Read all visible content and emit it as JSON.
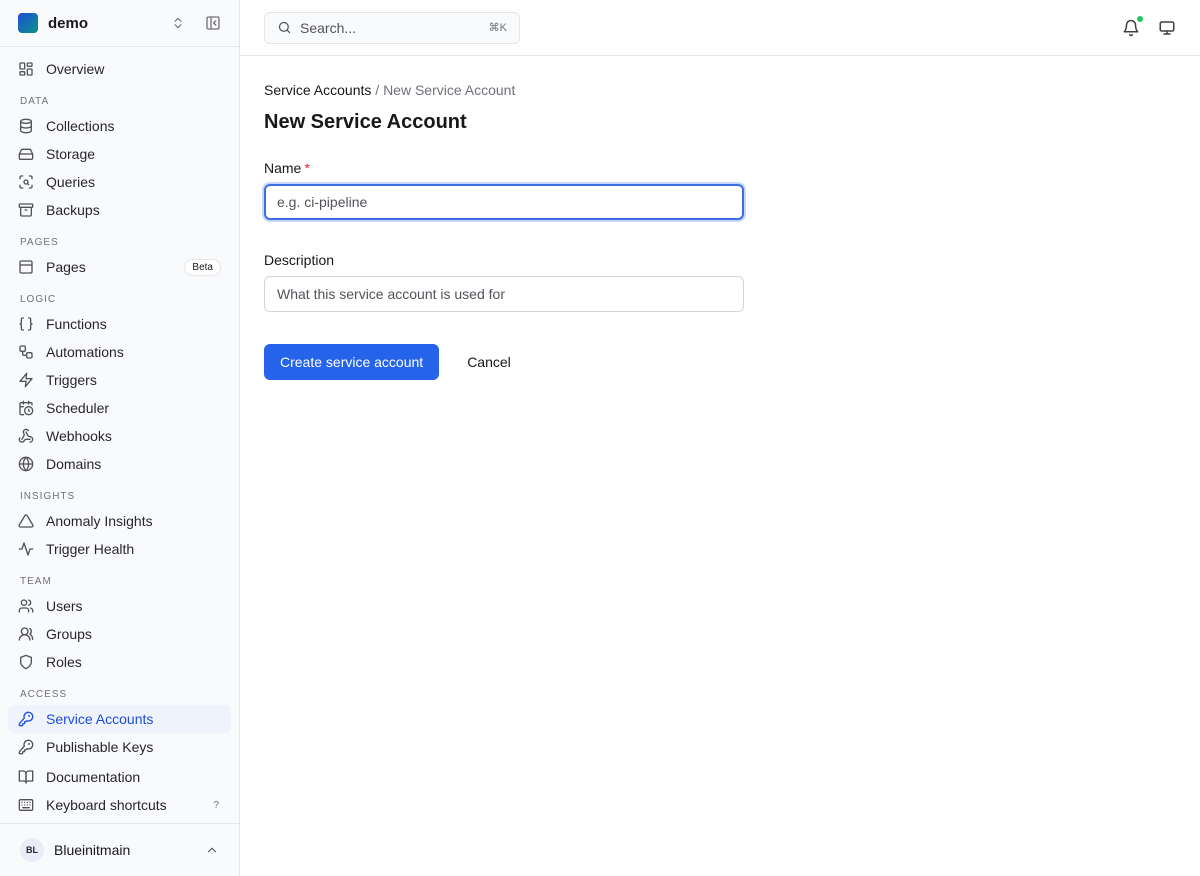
{
  "workspace": {
    "name": "demo"
  },
  "sidebar": {
    "overview": "Overview",
    "sections": [
      {
        "label": "DATA",
        "items": [
          {
            "label": "Collections",
            "icon": "database-icon"
          },
          {
            "label": "Storage",
            "icon": "hard-drive-icon"
          },
          {
            "label": "Queries",
            "icon": "scan-search-icon"
          },
          {
            "label": "Backups",
            "icon": "archive-icon"
          }
        ]
      },
      {
        "label": "PAGES",
        "items": [
          {
            "label": "Pages",
            "icon": "panel-top-icon",
            "badge": "Beta"
          }
        ]
      },
      {
        "label": "LOGIC",
        "items": [
          {
            "label": "Functions",
            "icon": "braces-icon"
          },
          {
            "label": "Automations",
            "icon": "workflow-icon"
          },
          {
            "label": "Triggers",
            "icon": "zap-icon"
          },
          {
            "label": "Scheduler",
            "icon": "calendar-clock-icon"
          },
          {
            "label": "Webhooks",
            "icon": "webhook-icon"
          },
          {
            "label": "Domains",
            "icon": "globe-icon"
          }
        ]
      },
      {
        "label": "INSIGHTS",
        "items": [
          {
            "label": "Anomaly Insights",
            "icon": "triangle-alert-icon"
          },
          {
            "label": "Trigger Health",
            "icon": "activity-icon"
          }
        ]
      },
      {
        "label": "TEAM",
        "items": [
          {
            "label": "Users",
            "icon": "users-icon"
          },
          {
            "label": "Groups",
            "icon": "users-round-icon"
          },
          {
            "label": "Roles",
            "icon": "shield-icon"
          }
        ]
      },
      {
        "label": "ACCESS",
        "items": [
          {
            "label": "Service Accounts",
            "icon": "key-icon",
            "active": true
          },
          {
            "label": "Publishable Keys",
            "icon": "key-icon"
          }
        ]
      }
    ],
    "documentation": "Documentation",
    "keyboard_shortcuts": "Keyboard shortcuts",
    "keyboard_hint": "?",
    "user": {
      "initials": "BL",
      "name": "Blueinitmain"
    }
  },
  "topbar": {
    "search_placeholder": "Search...",
    "search_shortcut": "⌘K"
  },
  "breadcrumb": {
    "parent": "Service Accounts",
    "separator": "/",
    "current": "New Service Account"
  },
  "page_title": "New Service Account",
  "form": {
    "name_label": "Name",
    "name_required": "*",
    "name_placeholder": "e.g. ci-pipeline",
    "description_label": "Description",
    "description_placeholder": "What this service account is used for",
    "submit_label": "Create service account",
    "cancel_label": "Cancel"
  },
  "colors": {
    "accent": "#2563eb",
    "active_bg": "#eff3fb",
    "notification": "#22c55e",
    "required": "#dc2626"
  }
}
